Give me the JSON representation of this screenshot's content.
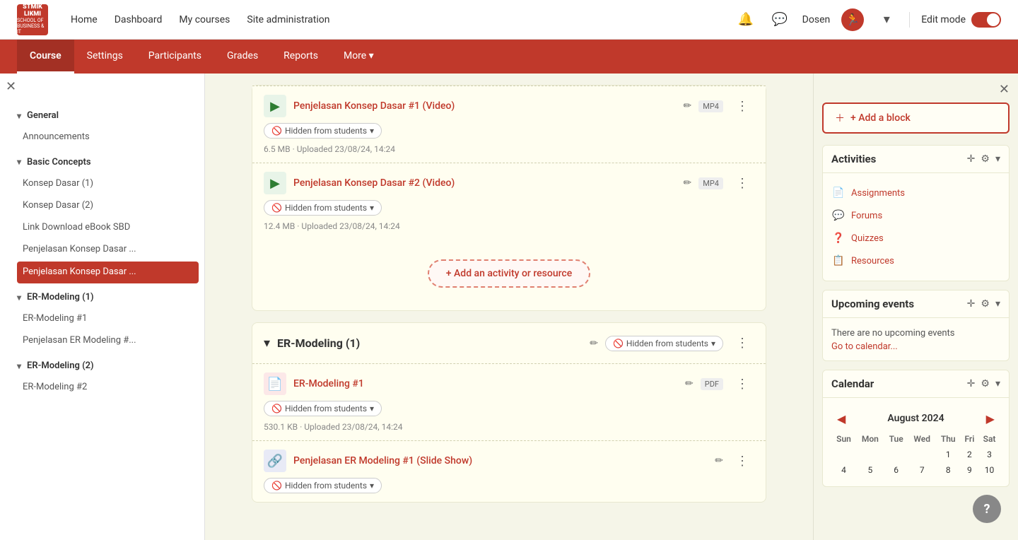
{
  "topNav": {
    "logoText": "STMIK LIKMI",
    "logoSub": "SCHOOL OF BUSINESS & IT",
    "links": [
      "Home",
      "Dashboard",
      "My courses",
      "Site administration"
    ],
    "userName": "Dosen",
    "editMode": "Edit mode"
  },
  "courseNav": {
    "items": [
      "Course",
      "Settings",
      "Participants",
      "Grades",
      "Reports",
      "More ▾"
    ],
    "activeIndex": 0
  },
  "sidebar": {
    "sections": [
      {
        "title": "General",
        "expanded": true,
        "items": [
          "Announcements"
        ]
      },
      {
        "title": "Basic Concepts",
        "expanded": true,
        "items": [
          "Konsep Dasar (1)",
          "Konsep Dasar (2)",
          "Link Download eBook SBD",
          "Penjelasan Konsep Dasar ...",
          "Penjelasan Konsep Dasar ..."
        ]
      },
      {
        "title": "ER-Modeling (1)",
        "expanded": true,
        "items": [
          "ER-Modeling #1",
          "Penjelasan ER Modeling #..."
        ]
      },
      {
        "title": "ER-Modeling (2)",
        "expanded": true,
        "items": [
          "ER-Modeling #2"
        ]
      }
    ],
    "activeItem": "Penjelasan Konsep Dasar ..."
  },
  "mainContent": {
    "sections": [
      {
        "id": "basic-concepts-top",
        "items": [
          {
            "type": "video",
            "name": "Penjelasan Konsep Dasar #1 (Video)",
            "fileType": "MP4",
            "hidden": true,
            "size": "6.5 MB",
            "uploaded": "Uploaded 23/08/24, 14:24"
          },
          {
            "type": "video",
            "name": "Penjelasan Konsep Dasar #2 (Video)",
            "fileType": "MP4",
            "hidden": true,
            "size": "12.4 MB",
            "uploaded": "Uploaded 23/08/24, 14:24"
          }
        ],
        "addActivity": "+ Add an activity or resource"
      },
      {
        "id": "er-modeling-1",
        "title": "ER-Modeling (1)",
        "hidden": true,
        "items": [
          {
            "type": "pdf",
            "name": "ER-Modeling #1",
            "fileType": "PDF",
            "hidden": true,
            "size": "530.1 KB",
            "uploaded": "Uploaded 23/08/24, 14:24"
          },
          {
            "type": "link",
            "name": "Penjelasan ER Modeling #1 (Slide Show)",
            "hidden": true
          }
        ]
      }
    ]
  },
  "rightPanel": {
    "addBlock": "+ Add a block",
    "widgets": [
      {
        "id": "activities",
        "title": "Activities",
        "links": [
          {
            "icon": "📄",
            "label": "Assignments"
          },
          {
            "icon": "💬",
            "label": "Forums"
          },
          {
            "icon": "❓",
            "label": "Quizzes"
          },
          {
            "icon": "📋",
            "label": "Resources"
          }
        ]
      },
      {
        "id": "upcoming-events",
        "title": "Upcoming events",
        "noEvents": "There are no upcoming events",
        "calendarLink": "Go to calendar..."
      },
      {
        "id": "calendar",
        "title": "Calendar",
        "month": "August 2024",
        "headers": [
          "Sun",
          "Mon",
          "Tue",
          "Wed",
          "Thu",
          "Fri",
          "Sat"
        ],
        "rows": [
          [
            "",
            "",
            "",
            "",
            "1",
            "2",
            "3"
          ],
          [
            "4",
            "5",
            "6",
            "7",
            "8",
            "9",
            "10"
          ]
        ]
      }
    ]
  },
  "help": "?"
}
